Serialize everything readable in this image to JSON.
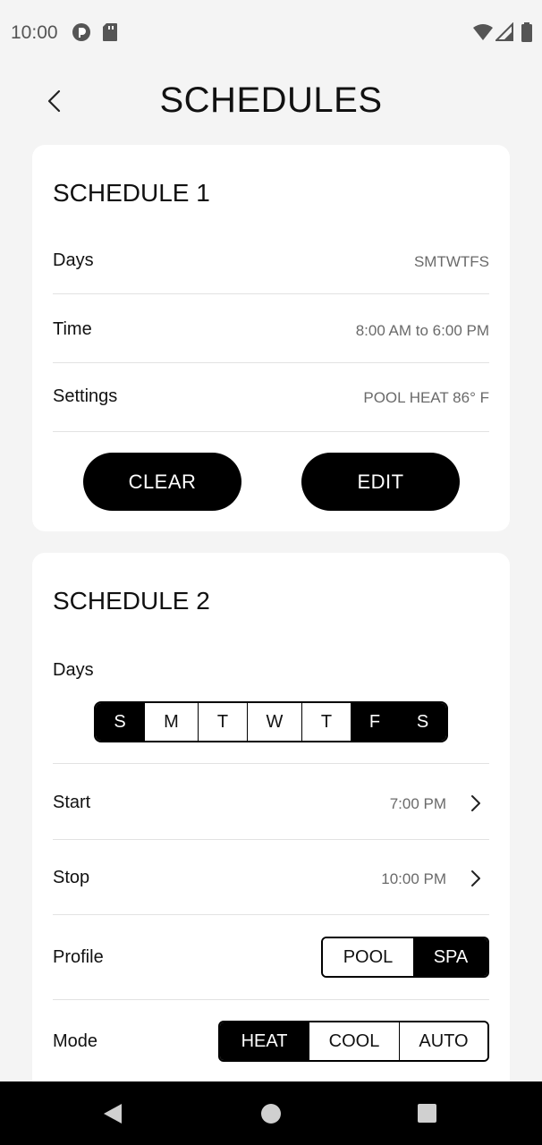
{
  "status_bar": {
    "time": "10:00",
    "icons": [
      "app-notification-icon",
      "sd-card-icon",
      "wifi-icon",
      "signal-icon",
      "battery-icon"
    ]
  },
  "header": {
    "title": "SCHEDULES",
    "back_icon": "chevron-left-icon"
  },
  "schedule1": {
    "title": "SCHEDULE 1",
    "rows": [
      {
        "label": "Days",
        "value": "SMTWTFS"
      },
      {
        "label": "Time",
        "value": "8:00 AM to 6:00 PM"
      },
      {
        "label": "Settings",
        "value": "POOL HEAT 86° F"
      }
    ],
    "clear_label": "CLEAR",
    "edit_label": "EDIT"
  },
  "schedule2": {
    "title": "SCHEDULE 2",
    "days_label": "Days",
    "days": [
      {
        "label": "S",
        "selected": true
      },
      {
        "label": "M",
        "selected": false
      },
      {
        "label": "T",
        "selected": false
      },
      {
        "label": "W",
        "selected": false
      },
      {
        "label": "T",
        "selected": false
      },
      {
        "label": "F",
        "selected": true
      },
      {
        "label": "S",
        "selected": true
      }
    ],
    "start_label": "Start",
    "start_value": "7:00 PM",
    "stop_label": "Stop",
    "stop_value": "10:00 PM",
    "profile_label": "Profile",
    "profile_options": [
      "POOL",
      "SPA"
    ],
    "profile_selected": "SPA",
    "mode_label": "Mode",
    "mode_options": [
      "HEAT",
      "COOL",
      "AUTO"
    ],
    "mode_selected": "HEAT"
  },
  "nav_bar": {
    "icons": [
      "back-triangle-icon",
      "home-circle-icon",
      "recents-square-icon"
    ]
  },
  "colors": {
    "background": "#f4f4f4",
    "card": "#ffffff",
    "accent": "#000000",
    "muted_text": "#6a6a6a"
  }
}
